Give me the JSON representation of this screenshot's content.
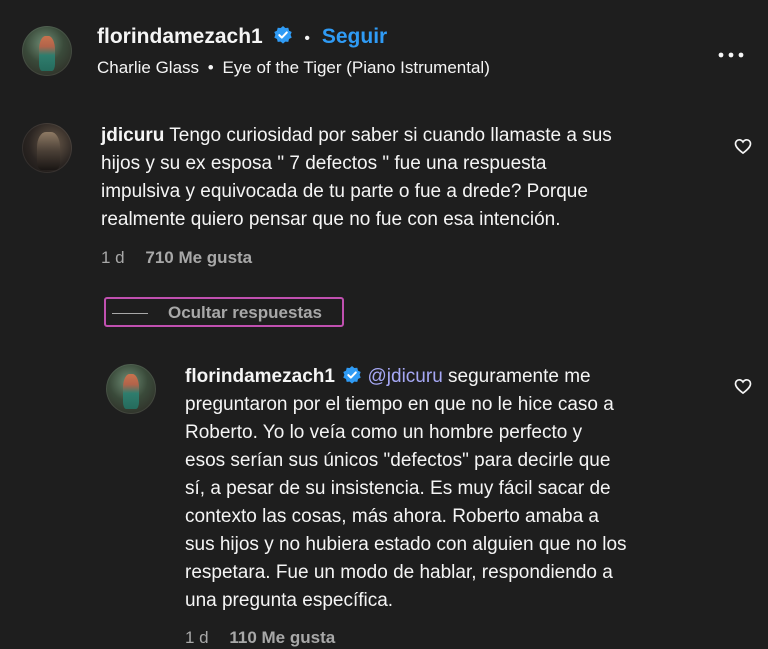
{
  "header": {
    "username": "florindamezach1",
    "separator": "•",
    "follow_label": "Seguir",
    "audio_artist": "Charlie Glass",
    "audio_separator": "•",
    "audio_title": "Eye of the Tiger (Piano Istrumental)",
    "more_icon": "more-horizontal-icon"
  },
  "comment": {
    "username": "jdicuru",
    "text_first": "Tengo curiosidad por saber si cuando llamaste a sus",
    "text_lines": [
      "hijos y su ex esposa \" 7 defectos \" fue una respuesta",
      "impulsiva y equivocada de tu parte o fue a drede? Porque",
      "realmente quiero pensar que no fue con esa intención."
    ],
    "time": "1 d",
    "likes": "710 Me gusta",
    "like_icon": "heart-icon"
  },
  "replies_toggle": {
    "label": "Ocultar respuestas"
  },
  "reply": {
    "username": "florindamezach1",
    "mention": "@jdicuru",
    "text_first": "seguramente me",
    "text_lines": [
      "preguntaron por el tiempo en que no le hice caso a",
      "Roberto. Yo lo veía como un hombre perfecto y",
      "esos serían sus únicos \"defectos\" para decirle que",
      "sí, a pesar de su insistencia. Es muy fácil sacar de",
      "contexto las cosas, más ahora. Roberto amaba a",
      "sus hijos y no hubiera estado con alguien que no los",
      "respetara. Fue un modo de hablar, respondiendo a",
      "una pregunta específica."
    ],
    "time": "1 d",
    "likes": "110 Me gusta",
    "like_icon": "heart-icon"
  },
  "colors": {
    "background": "#1e1e1e",
    "accent_blue": "#2f9bf5",
    "mention": "#a6a8f5",
    "muted": "#a8a8a8",
    "focus_outline": "#c050b0"
  }
}
